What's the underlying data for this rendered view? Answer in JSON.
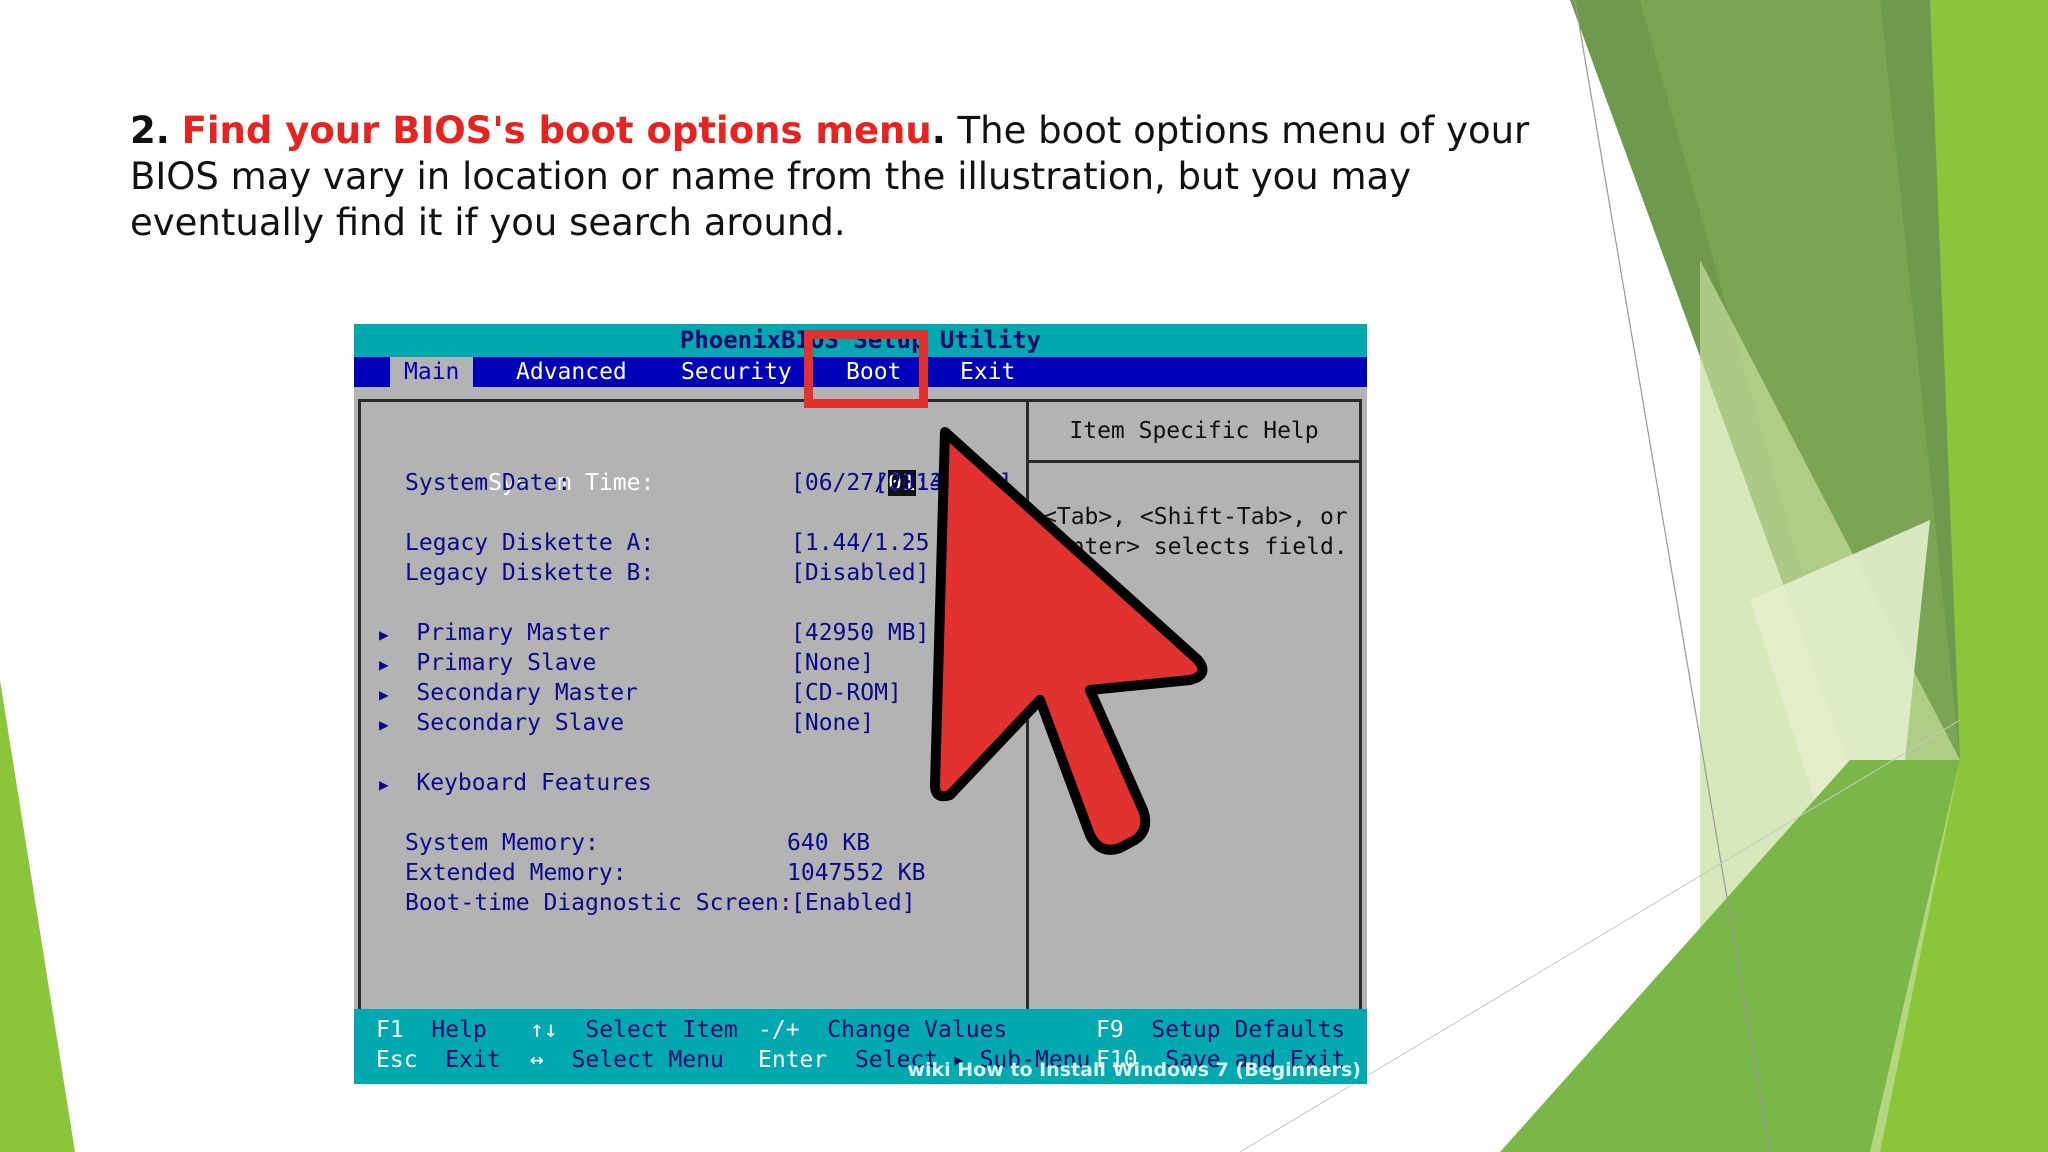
{
  "caption": {
    "number": "2.",
    "highlight": "Find your BIOS's boot options menu",
    "period": ".",
    "text": " The boot options menu of your BIOS may vary in location or name from the illustration, but you may eventually find it if you search around."
  },
  "colors": {
    "highlight": "#e8231f",
    "cursor_arrow": "#e2322f",
    "bios_blue": "#0000b8",
    "bios_teal": "#00a8b0",
    "bios_gray": "#b3b3b3",
    "green_accent": "#7ab648"
  },
  "bios": {
    "title": "PhoenixBIOS Setup Utility",
    "menu": [
      "Main",
      "Advanced",
      "Security",
      "Boot",
      "Exit"
    ],
    "active_menu": "Main",
    "items": [
      {
        "label": "System Time:",
        "value": "[01:34:03]",
        "selected": true
      },
      {
        "label": "System Date:",
        "value": "[06/27/2014]"
      },
      {
        "label": "Legacy Diskette A:",
        "value": "[1.44/1.25 MB]"
      },
      {
        "label": "Legacy Diskette B:",
        "value": "[Disabled]"
      },
      {
        "label": "Primary Master",
        "value": "[42950 MB]",
        "submenu": true
      },
      {
        "label": "Primary Slave",
        "value": "[None]",
        "submenu": true
      },
      {
        "label": "Secondary Master",
        "value": "[CD-ROM]",
        "submenu": true
      },
      {
        "label": "Secondary Slave",
        "value": "[None]",
        "submenu": true
      },
      {
        "label": "Keyboard Features",
        "value": "",
        "submenu": true
      },
      {
        "label": "System Memory:",
        "value": "640 KB"
      },
      {
        "label": "Extended Memory:",
        "value": "1047552 KB"
      },
      {
        "label": "Boot-time Diagnostic Screen:",
        "value": "[Enabled]"
      }
    ],
    "time_cursor": "01",
    "time_rest": ":34:03]",
    "help_title": "Item Specific Help",
    "help_line1": "<Tab>, <Shift-Tab>, or",
    "help_line2": "<Enter> selects field.",
    "footer": {
      "f1_key": "F1",
      "f1_desc": "Help",
      "updown_key": "↑↓",
      "updown_desc": "Select Item",
      "plusminus_key": "-/+",
      "plusminus_desc": "Change Values",
      "f9_key": "F9",
      "f9_desc": "Setup Defaults",
      "esc_key": "Esc",
      "esc_desc": "Exit",
      "leftright_key": "↔",
      "leftright_desc": "Select Menu",
      "enter_key": "Enter",
      "enter_desc": "Select ▸ Sub-Menu",
      "f10_key": "F10",
      "f10_desc": "Save and Exit"
    },
    "watermark": "wiki How to Install Windows 7 (Beginners)"
  },
  "icons": {
    "pointer": "mouse-pointer-arrow-icon",
    "submenu": "triangle-right-icon"
  }
}
